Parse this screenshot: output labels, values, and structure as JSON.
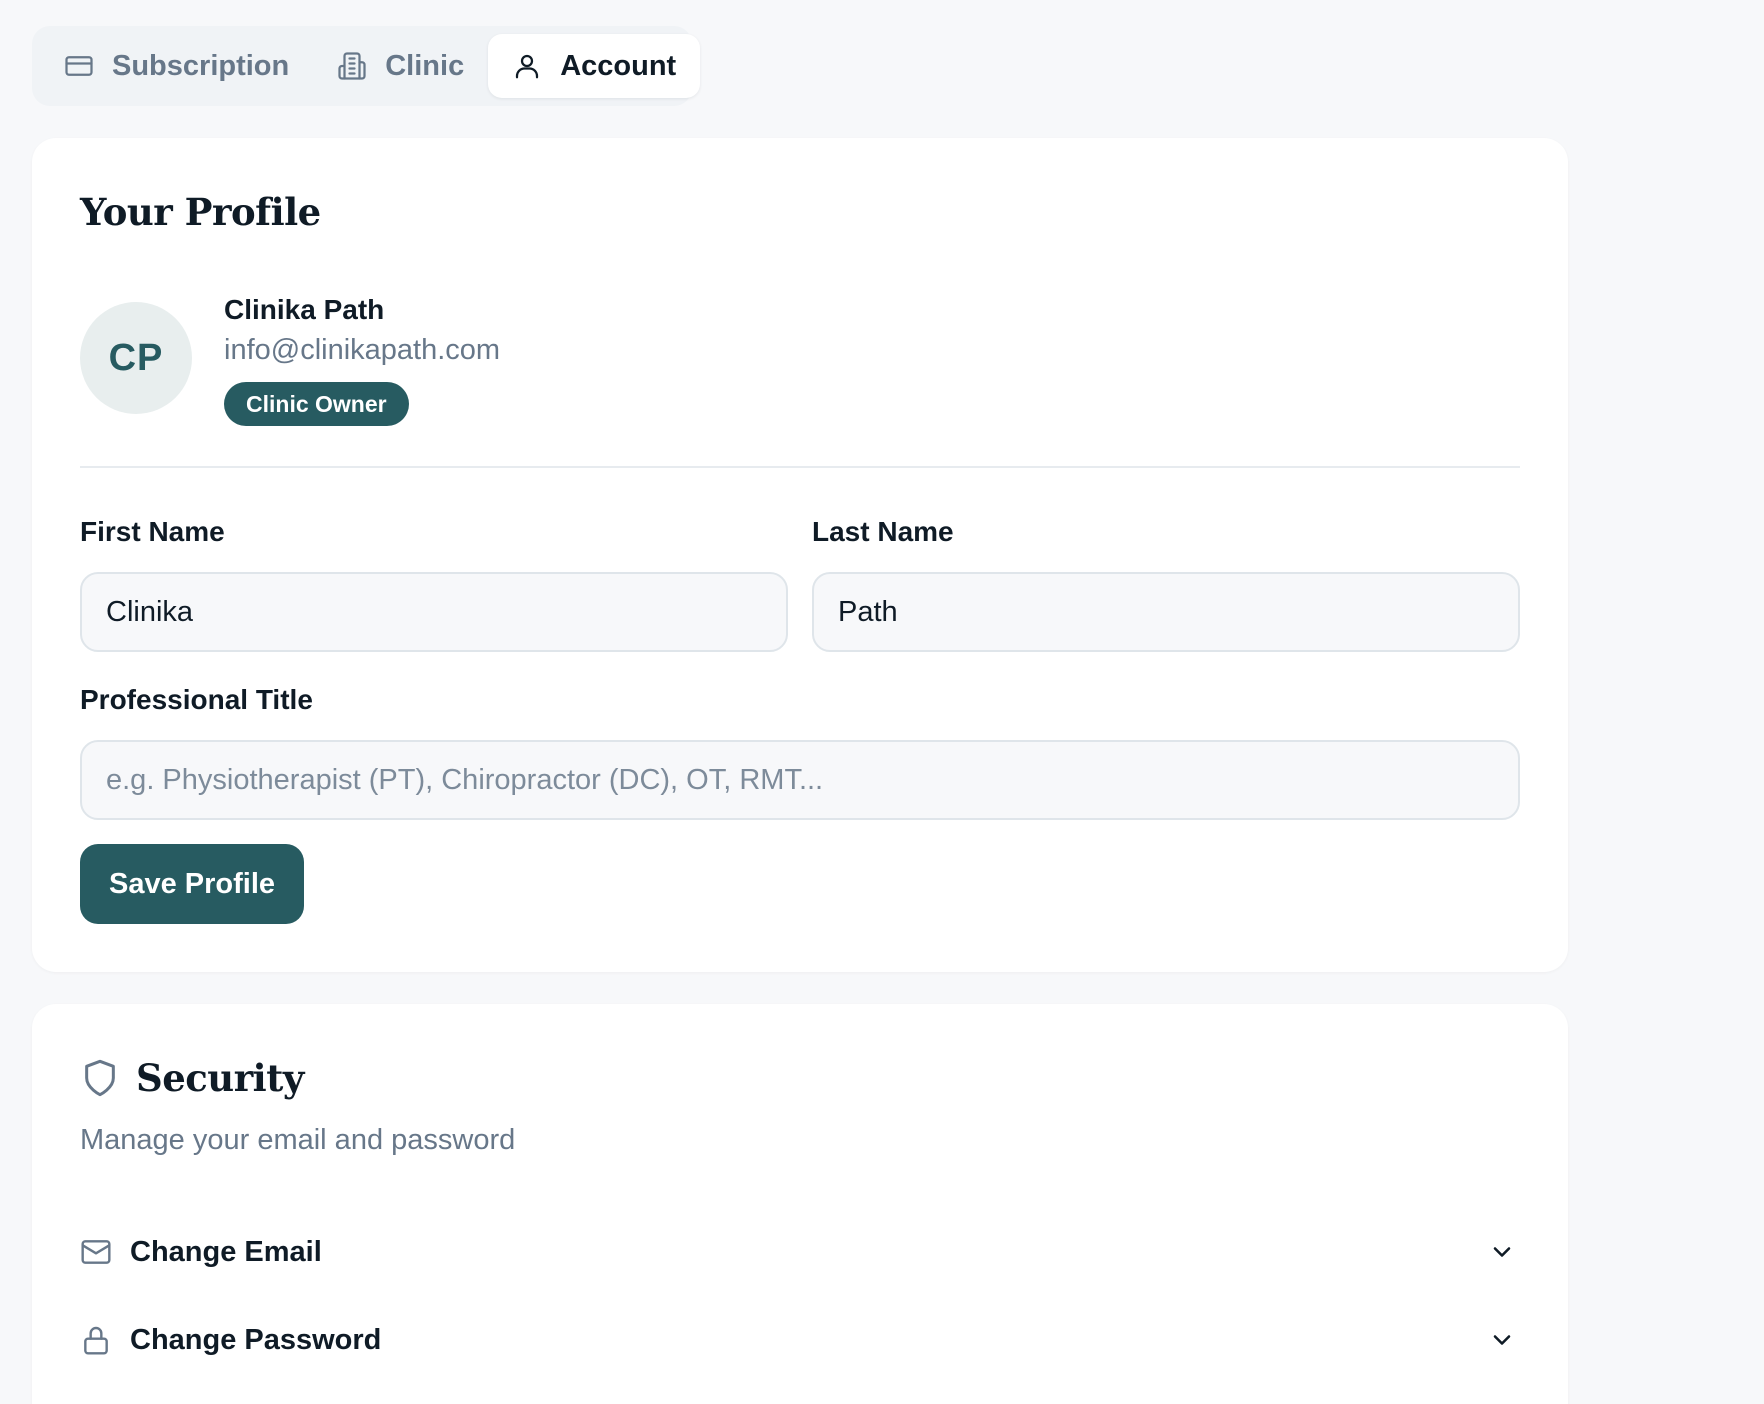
{
  "tabs": [
    {
      "label": "Subscription",
      "icon": "credit-card-icon"
    },
    {
      "label": "Clinic",
      "icon": "building-icon"
    },
    {
      "label": "Account",
      "icon": "user-icon",
      "active": true
    }
  ],
  "profile": {
    "title": "Your Profile",
    "initials": "CP",
    "name": "Clinika Path",
    "email": "info@clinikapath.com",
    "role": "Clinic Owner",
    "first_name_label": "First Name",
    "first_name_value": "Clinika",
    "last_name_label": "Last Name",
    "last_name_value": "Path",
    "professional_title_label": "Professional Title",
    "professional_title_placeholder": "e.g. Physiotherapist (PT), Chiropractor (DC), OT, RMT...",
    "save_label": "Save Profile"
  },
  "security": {
    "title": "Security",
    "subtitle": "Manage your email and password",
    "items": [
      {
        "label": "Change Email",
        "icon": "mail-icon"
      },
      {
        "label": "Change Password",
        "icon": "lock-icon"
      }
    ]
  },
  "colors": {
    "accent": "#275b61",
    "background": "#f7f8fa",
    "muted_text": "#677789"
  }
}
